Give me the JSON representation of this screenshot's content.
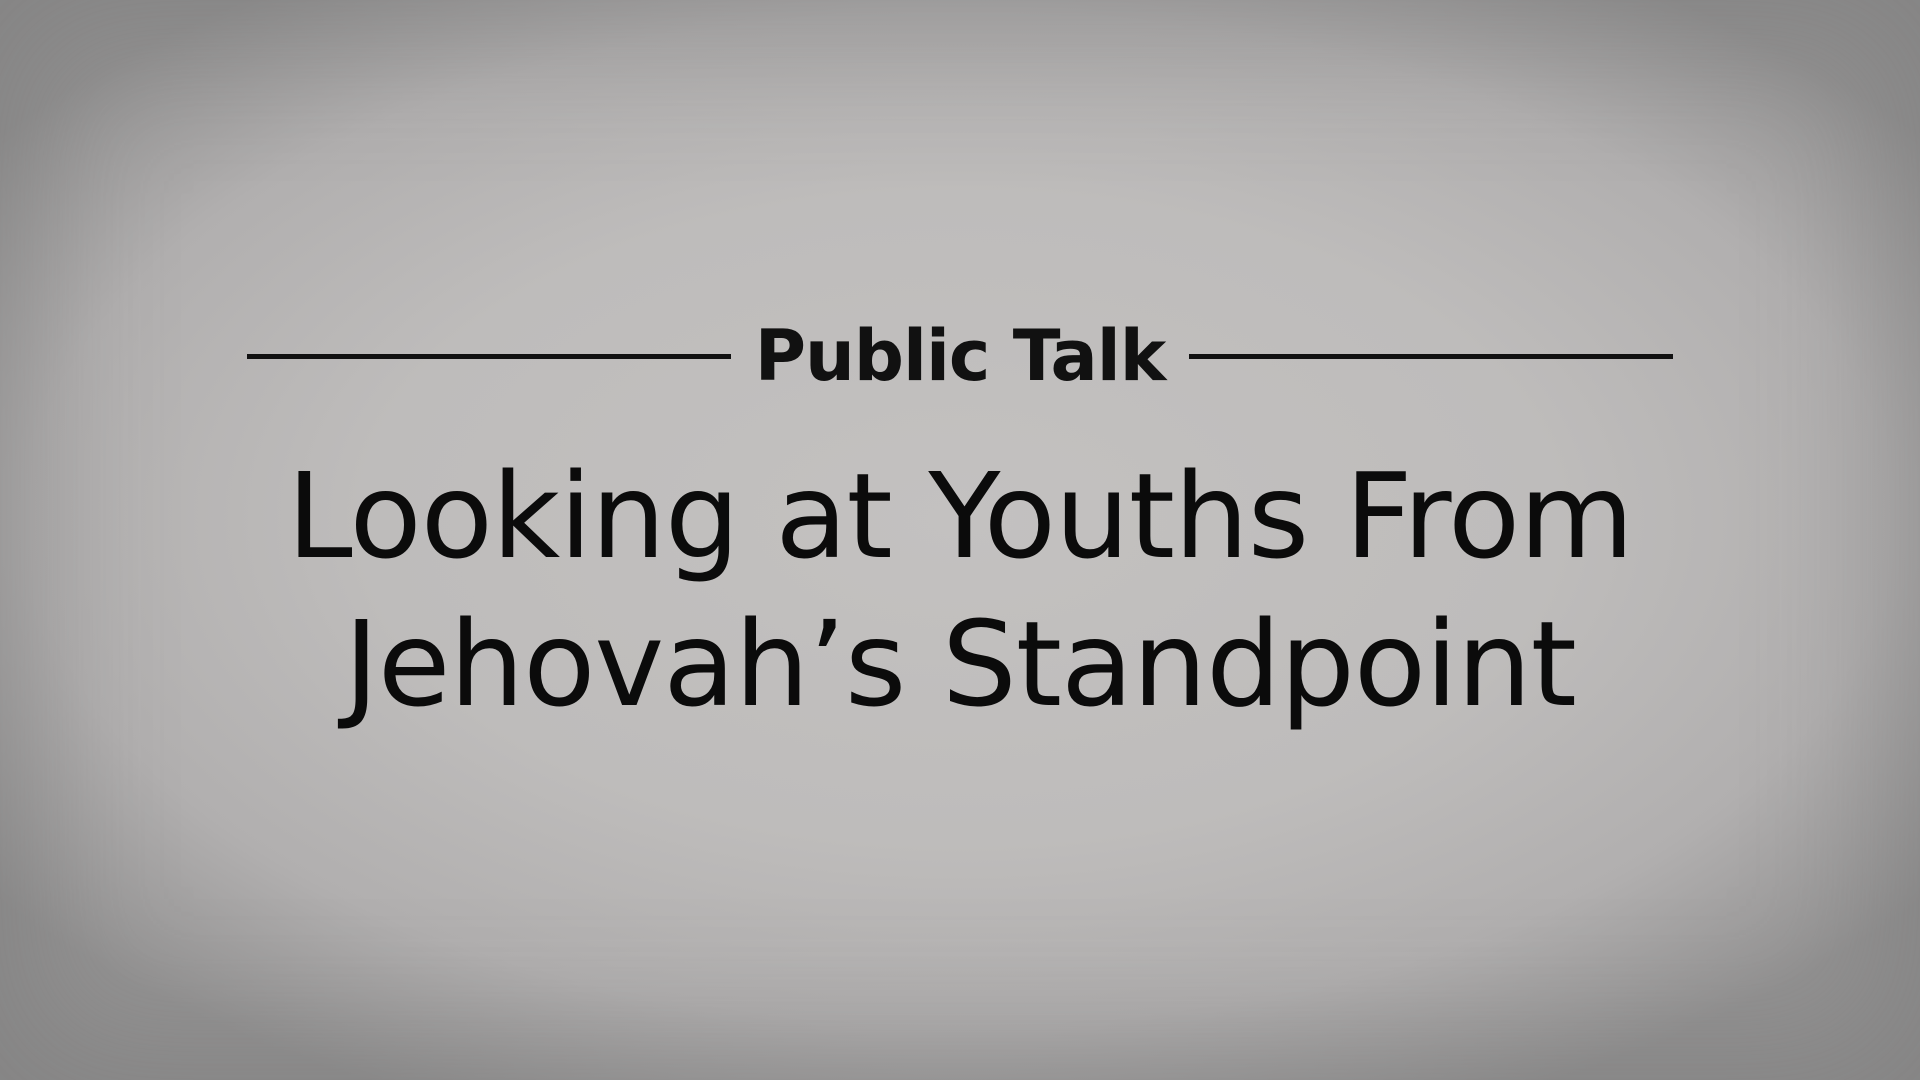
{
  "slide": {
    "label": "Public Talk",
    "title_lines": [
      "Looking at Youths From",
      "Jehovah’s Standpoint"
    ]
  },
  "colors": {
    "background": "#bdbbbb",
    "text": "#111111",
    "rule": "#111111"
  }
}
